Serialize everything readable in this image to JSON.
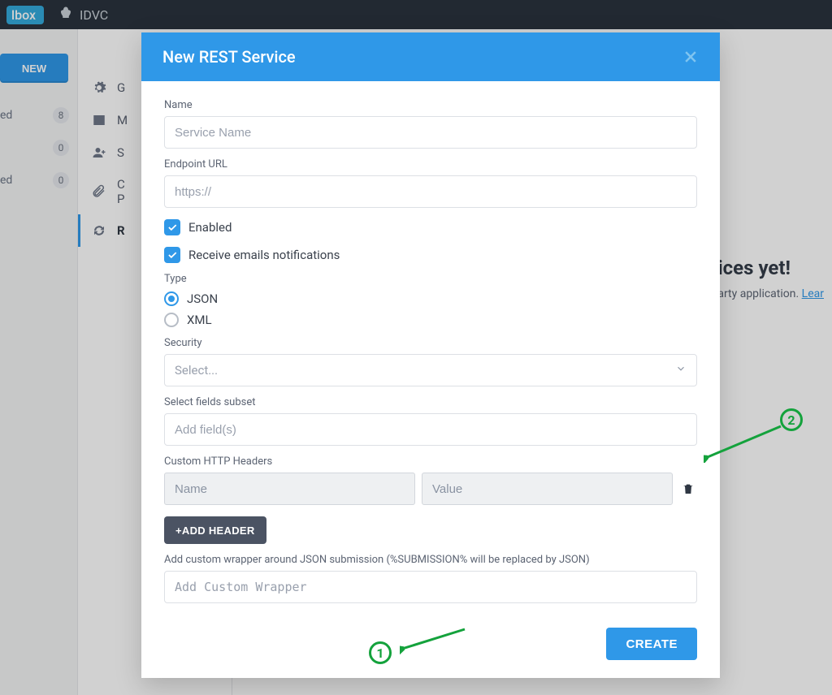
{
  "topnav": {
    "brand_partial": "lbox",
    "app_name": "IDVC"
  },
  "sidebar": {
    "new_label": "NEW",
    "items": [
      {
        "label": "ed",
        "count": "8"
      },
      {
        "label": "",
        "count": "0"
      },
      {
        "label": "ed",
        "count": "0"
      }
    ]
  },
  "content_menu": {
    "items": [
      {
        "label": "G"
      },
      {
        "label": "M"
      },
      {
        "label": "S"
      },
      {
        "label": "C"
      },
      {
        "label2": "P"
      },
      {
        "label": "R"
      }
    ]
  },
  "bg_empty": {
    "title": "ices yet!",
    "desc": "arty application.",
    "link": "Lear"
  },
  "modal": {
    "title": "New REST Service",
    "name_label": "Name",
    "name_placeholder": "Service Name",
    "url_label": "Endpoint URL",
    "url_placeholder": "https://",
    "enabled_label": "Enabled",
    "emails_label": "Receive emails notifications",
    "type_label": "Type",
    "type_json": "JSON",
    "type_xml": "XML",
    "security_label": "Security",
    "security_placeholder": "Select...",
    "subset_label": "Select fields subset",
    "subset_placeholder": "Add field(s)",
    "headers_label": "Custom HTTP Headers",
    "header_name_placeholder": "Name",
    "header_value_placeholder": "Value",
    "add_header_label": "+ADD HEADER",
    "wrapper_label": "Add custom wrapper around JSON submission (%SUBMISSION% will be replaced by JSON)",
    "wrapper_placeholder": "Add Custom Wrapper",
    "create_label": "CREATE"
  },
  "annotations": {
    "one": "1",
    "two": "2"
  }
}
